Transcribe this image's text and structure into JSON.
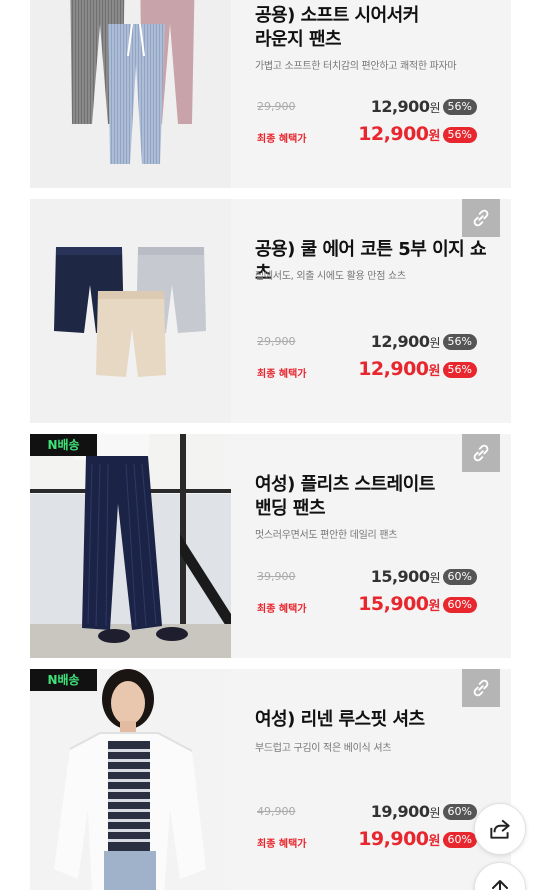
{
  "products": [
    {
      "title_line1": "공용) 소프트 시어서커",
      "title_line2": "라운지 팬츠",
      "desc": "가볍고 소프트한 터치감의 편안하고 쾌적한 파자마",
      "orig_price": "29,900",
      "price": "12,900",
      "won": "원",
      "discount": "56%",
      "final_label": "최종 혜택가",
      "final_price": "12,900",
      "final_discount": "56%",
      "link_icon": "link-icon"
    },
    {
      "title_line1": "공용) 쿨 에어 코튼 5부 이지 쇼츠",
      "title_line2": "",
      "desc": "집에서도, 외출 시에도 활용 만점 쇼츠",
      "orig_price": "29,900",
      "price": "12,900",
      "won": "원",
      "discount": "56%",
      "final_label": "최종 혜택가",
      "final_price": "12,900",
      "final_discount": "56%",
      "link_icon": "link-icon"
    },
    {
      "badge": "N배송",
      "title_line1": "여성) 플리츠 스트레이트",
      "title_line2": "밴딩 팬츠",
      "desc": "멋스러우면서도 편안한 데일리 팬츠",
      "orig_price": "39,900",
      "price": "15,900",
      "won": "원",
      "discount": "60%",
      "final_label": "최종 혜택가",
      "final_price": "15,900",
      "final_discount": "60%",
      "link_icon": "link-icon"
    },
    {
      "badge": "N배송",
      "title_line1": "여성) 리넨 루스핏 셔츠",
      "title_line2": "",
      "desc": "부드럽고 구김이 적은 베이식 셔츠",
      "orig_price": "49,900",
      "price": "19,900",
      "won": "원",
      "discount": "60%",
      "final_label": "최종 혜택가",
      "final_price": "19,900",
      "final_discount": "60%",
      "link_icon": "link-icon"
    }
  ],
  "floating": {
    "share_icon": "share-icon",
    "top_icon": "arrow-up-icon"
  },
  "colors": {
    "accent_red": "#e8262e",
    "badge_green": "#3fe37a",
    "card_bg": "#f4f4f4"
  }
}
